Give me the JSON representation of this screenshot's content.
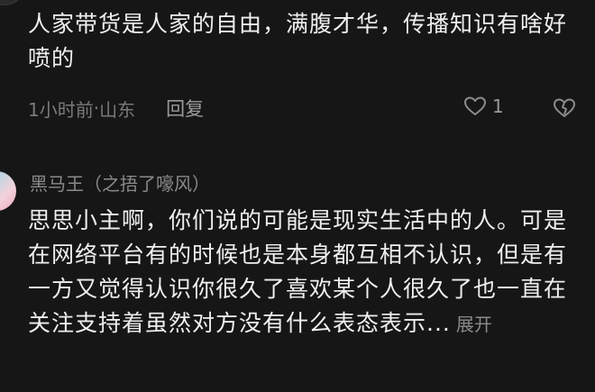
{
  "comment1": {
    "text": "人家带货是人家的自由，满腹才华，传播知识有啥好喷的",
    "time": "1小时前",
    "separator": " · ",
    "location": "山东",
    "reply_label": "回复",
    "like_count": "1",
    "icons": [
      "heart-outline-icon",
      "broken-heart-icon"
    ]
  },
  "comment2": {
    "username": "黑马王（之捂了嚎风）",
    "text": "思思小主啊，你们说的可能是现实生活中的人。可是在网络平台有的时候也是本身都互相不认识，但是有一方又觉得认识你很久了喜欢某个人很久了也一直在关注支持着虽然对方没有什么表态表示...",
    "expand_label": "展开"
  },
  "colors": {
    "background": "#161616",
    "text": "#efefef",
    "muted": "#7a7a7a"
  }
}
